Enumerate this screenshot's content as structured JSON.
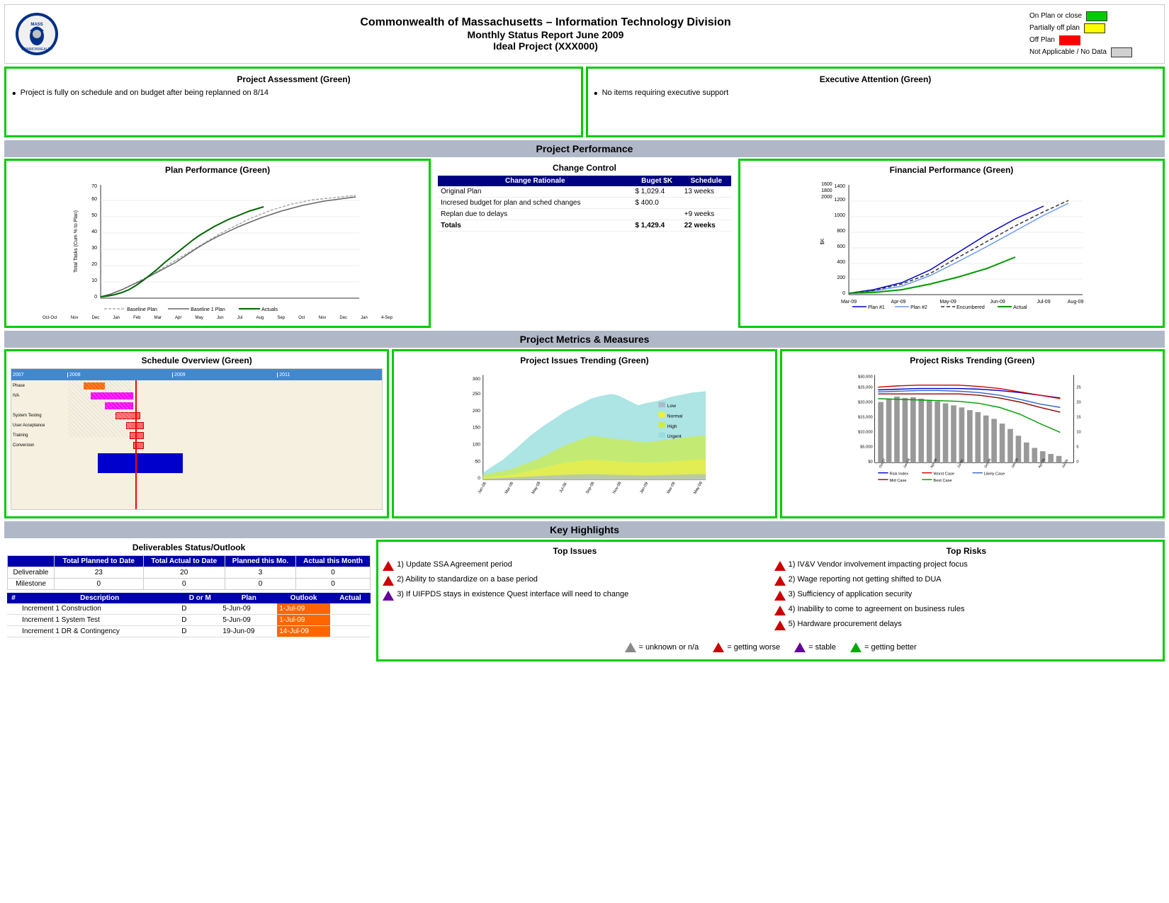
{
  "header": {
    "title_line1": "Commonwealth of Massachusetts – Information Technology Division",
    "title_line2": "Monthly Status Report June 2009",
    "title_line3": "Ideal Project (XXX000)"
  },
  "legend": {
    "items": [
      {
        "label": "On Plan or close",
        "color": "green"
      },
      {
        "label": "Partially off plan",
        "color": "yellow"
      },
      {
        "label": "Off Plan",
        "color": "red"
      },
      {
        "label": "Not Applicable / No Data",
        "color": "gray"
      }
    ]
  },
  "project_assessment": {
    "title": "Project Assessment (Green)",
    "content": "Project is fully on schedule and on budget after being replanned on 8/14"
  },
  "executive_attention": {
    "title": "Executive Attention (Green)",
    "content": "No items requiring executive support"
  },
  "performance_section_title": "Project Performance",
  "plan_performance": {
    "title": "Plan Performance (Green)"
  },
  "change_control": {
    "title": "Change Control",
    "table_headers": [
      "Change Rationale",
      "Buget $K",
      "Schedule"
    ],
    "rows": [
      {
        "rationale": "Original Plan",
        "budget": "$ 1,029.4",
        "schedule": "13 weeks"
      },
      {
        "rationale": "Incresed budget for plan and sched changes",
        "budget": "$   400.0",
        "schedule": ""
      },
      {
        "rationale": "Replan due to delays",
        "budget": "",
        "schedule": "+9 weeks"
      },
      {
        "rationale": "Totals",
        "budget": "$ 1,429.4",
        "schedule": "22 weeks"
      }
    ]
  },
  "financial_performance": {
    "title": "Financial Performance (Green)",
    "legend": [
      "Plan #1",
      "Plan #2",
      "Encumbered",
      "Actual"
    ]
  },
  "metrics_section_title": "Project Metrics & Measures",
  "schedule_overview": {
    "title": "Schedule Overview (Green)"
  },
  "issues_trending": {
    "title": "Project Issues Trending (Green)",
    "legend": [
      "Low",
      "Normal",
      "High",
      "Urgent"
    ]
  },
  "risks_trending": {
    "title": "Project Risks Trending (Green)",
    "legend": [
      "Risk Index",
      "Worst Case",
      "Likely Case",
      "Mid Case",
      "Best Case"
    ]
  },
  "key_highlights": {
    "section_title": "Key Highlights",
    "top_issues": {
      "title": "Top Issues",
      "items": [
        "Update SSA Agreement period",
        "Ability to standardize on a base period",
        "If UIFPDS stays in existence Quest interface will need to change"
      ]
    },
    "top_risks": {
      "title": "Top Risks",
      "items": [
        "IV&V Vendor involvement impacting project focus",
        "Wage reporting not getting shifted to DUA",
        "Sufficiency of application security",
        "Inability to come to agreement on business rules",
        "Hardware procurement delays"
      ]
    }
  },
  "deliverables": {
    "title": "Deliverables Status/Outlook",
    "summary_headers": [
      "",
      "Total Planned to Date",
      "Total Actual to Date",
      "Planned this Mo.",
      "Actual this Month"
    ],
    "summary_rows": [
      {
        "label": "Deliverable",
        "planned": "23",
        "actual": "20",
        "planned_mo": "3",
        "actual_mo": "0"
      },
      {
        "label": "Milestone",
        "planned": "0",
        "actual": "0",
        "planned_mo": "0",
        "actual_mo": "0"
      }
    ],
    "detail_headers": [
      "#",
      "Description",
      "D or M",
      "Plan",
      "Outlook",
      "Actual"
    ],
    "detail_rows": [
      {
        "num": "",
        "desc": "Increment 1 Construction",
        "dom": "D",
        "plan": "5-Jun-09",
        "outlook": "1-Jul-09",
        "actual": ""
      },
      {
        "num": "",
        "desc": "Increment 1 System Test",
        "dom": "D",
        "plan": "5-Jun-09",
        "outlook": "1-Jul-09",
        "actual": ""
      },
      {
        "num": "",
        "desc": "Increment 1 DR & Contingency",
        "dom": "D",
        "plan": "19-Jun-09",
        "outlook": "14-Jul-09",
        "actual": ""
      }
    ]
  },
  "bottom_legend": {
    "items": [
      {
        "symbol": "gray_triangle",
        "label": "= unknown or n/a"
      },
      {
        "symbol": "red_triangle",
        "label": "= getting worse"
      },
      {
        "symbol": "purple_triangle",
        "label": "= stable"
      },
      {
        "symbol": "green_triangle",
        "label": "= getting better"
      }
    ]
  }
}
